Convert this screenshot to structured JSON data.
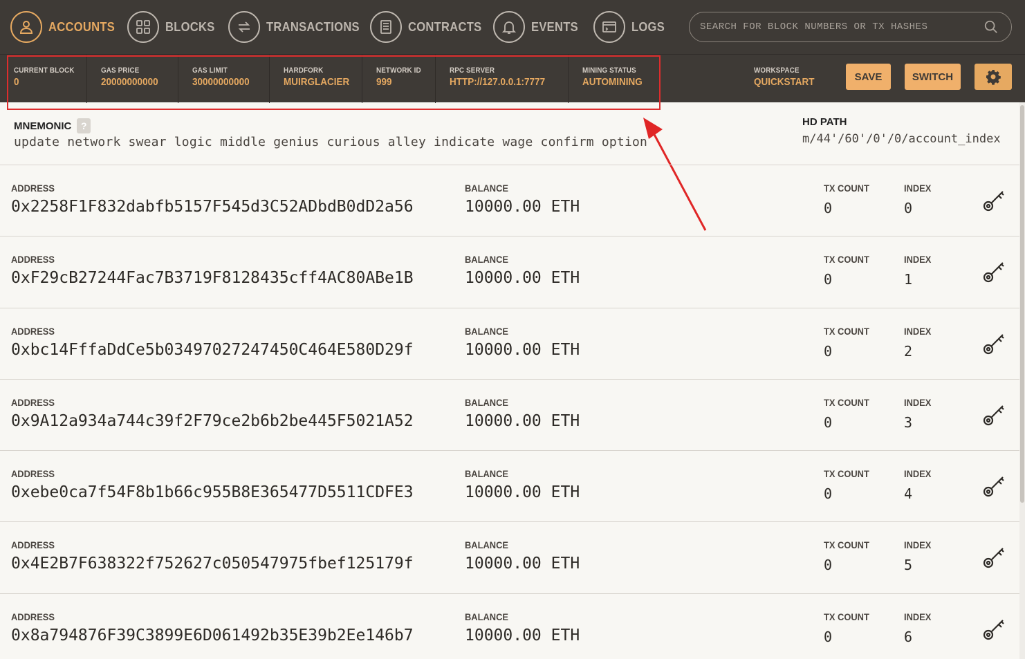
{
  "nav": {
    "accounts": "ACCOUNTS",
    "blocks": "BLOCKS",
    "transactions": "TRANSACTIONS",
    "contracts": "CONTRACTS",
    "events": "EVENTS",
    "logs": "LOGS",
    "search_placeholder": "SEARCH FOR BLOCK NUMBERS OR TX HASHES"
  },
  "status": {
    "current_block_label": "CURRENT BLOCK",
    "current_block": "0",
    "gas_price_label": "GAS PRICE",
    "gas_price": "20000000000",
    "gas_limit_label": "GAS LIMIT",
    "gas_limit": "30000000000",
    "hardfork_label": "HARDFORK",
    "hardfork": "MUIRGLACIER",
    "network_id_label": "NETWORK ID",
    "network_id": "999",
    "rpc_server_label": "RPC SERVER",
    "rpc_server": "HTTP://127.0.0.1:7777",
    "mining_status_label": "MINING STATUS",
    "mining_status": "AUTOMINING",
    "workspace_label": "WORKSPACE",
    "workspace": "QUICKSTART",
    "save_label": "SAVE",
    "switch_label": "SWITCH"
  },
  "mnemonic": {
    "label": "MNEMONIC",
    "help": "?",
    "words": "update network swear logic middle genius curious alley indicate wage confirm option",
    "hd_path_label": "HD PATH",
    "hd_path": "m/44'/60'/0'/0/account_index"
  },
  "account_labels": {
    "address": "ADDRESS",
    "balance": "BALANCE",
    "tx_count": "TX COUNT",
    "index": "INDEX"
  },
  "accounts": [
    {
      "address": "0x2258F1F832dabfb5157F545d3C52ADbdB0dD2a56",
      "balance": "10000.00 ETH",
      "tx_count": "0",
      "index": "0"
    },
    {
      "address": "0xF29cB27244Fac7B3719F8128435cff4AC80ABe1B",
      "balance": "10000.00 ETH",
      "tx_count": "0",
      "index": "1"
    },
    {
      "address": "0xbc14FffaDdCe5b03497027247450C464E580D29f",
      "balance": "10000.00 ETH",
      "tx_count": "0",
      "index": "2"
    },
    {
      "address": "0x9A12a934a744c39f2F79ce2b6b2be445F5021A52",
      "balance": "10000.00 ETH",
      "tx_count": "0",
      "index": "3"
    },
    {
      "address": "0xebe0ca7f54F8b1b66c955B8E365477D5511CDFE3",
      "balance": "10000.00 ETH",
      "tx_count": "0",
      "index": "4"
    },
    {
      "address": "0x4E2B7F638322f752627c050547975fbef125179f",
      "balance": "10000.00 ETH",
      "tx_count": "0",
      "index": "5"
    },
    {
      "address": "0x8a794876F39C3899E6D061492b35E39b2Ee146b7",
      "balance": "10000.00 ETH",
      "tx_count": "0",
      "index": "6"
    }
  ],
  "colors": {
    "nav_bg": "#3e3a36",
    "accent": "#e6a961",
    "button": "#f0b06b",
    "annotation": "#dd2d2d"
  }
}
